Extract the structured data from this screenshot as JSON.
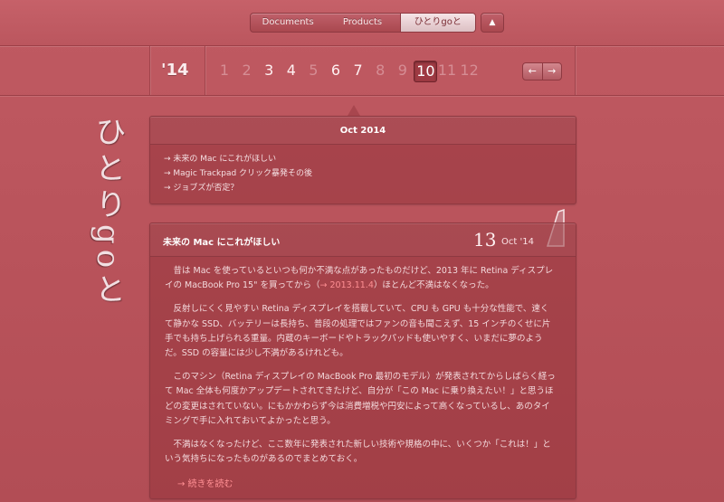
{
  "topnav": {
    "tabs": [
      "Documents",
      "Products",
      "ひとりgoと"
    ],
    "active_tab": 2,
    "up_label": "▲"
  },
  "archive": {
    "year": "'14",
    "months": [
      "1",
      "2",
      "3",
      "4",
      "5",
      "6",
      "7",
      "8",
      "9",
      "10",
      "11",
      "12"
    ],
    "months_with_posts": [
      "3",
      "4",
      "6",
      "7",
      "10"
    ],
    "current_month": "10",
    "prev_label": "←",
    "next_label": "→"
  },
  "logo": {
    "text": "ひとりgoと"
  },
  "month_panel": {
    "title": "Oct 2014",
    "items": [
      "→ 未来の Mac にこれがほしい",
      "→ Magic Trackpad クリック暴発その後",
      "→ ジョブズが否定？"
    ]
  },
  "article": {
    "title": "未来の Mac にこれがほしい",
    "day": "13",
    "month_year": "Oct '14",
    "p1_before": "昔は Mac を使っているといつも何か不満な点があったものだけど、2013 年に Retina ディスプレイの MacBook Pro 15\" を買ってから（",
    "p1_link": "→ 2013.11.4",
    "p1_after": "）ほとんど不満はなくなった。",
    "p2": "反射しにくく見やすい Retina ディスプレイを搭載していて、CPU も GPU も十分な性能で、速くて静かな SSD、バッテリーは長持ち、普段の処理ではファンの音も聞こえず、15 インチのくせに片手でも持ち上げられる重量。内蔵のキーボードやトラックパッドも使いやすく、いまだに夢のようだ。SSD の容量には少し不満があるけれども。",
    "p3": "このマシン（Retina ディスプレイの MacBook Pro 最初のモデル）が発表されてからしばらく経って Mac 全体も何度かアップデートされてきたけど、自分が「この Mac に乗り換えたい！」と思うほどの変更はされていない。にもかかわらず今は消費増税や円安によって高くなっているし、あのタイミングで手に入れておいてよかったと思う。",
    "p4": "不満はなくなったけど、ここ数年に発表された新しい技術や規格の中に、いくつか「これは！」という気持ちになったものがあるのでまとめておく。",
    "read_more": "→ 続きを読む"
  }
}
